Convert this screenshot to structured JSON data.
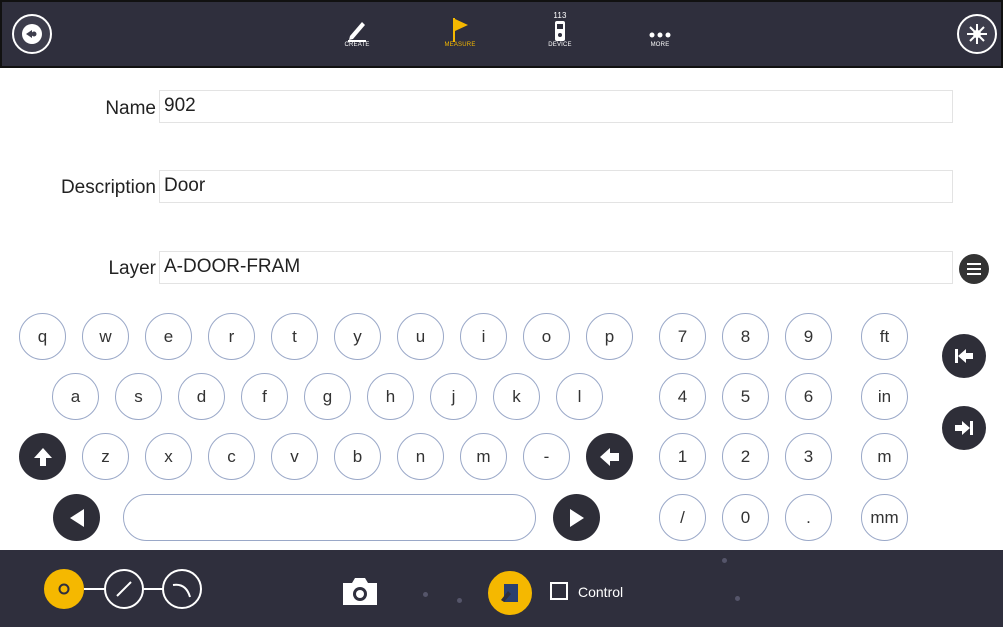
{
  "topbar": {
    "tabs": [
      {
        "label": "CREATE",
        "icon": "pencil-icon"
      },
      {
        "label": "MEASURE",
        "icon": "flag-icon"
      },
      {
        "label": "DEVICE",
        "icon": "device-icon"
      },
      {
        "label": "MORE",
        "icon": "more-dots-icon"
      }
    ],
    "left_icon": "back-target-icon",
    "right_icon": "laser-burst-icon",
    "device_badge": "113",
    "active_tab": "MEASURE",
    "active_color": "#f5b800"
  },
  "form": {
    "name_label": "Name",
    "name_value": "902",
    "description_label": "Description",
    "description_value": "Door",
    "layer_label": "Layer",
    "layer_value": "A-DOOR-FRAM"
  },
  "keyboard": {
    "row1": [
      "q",
      "w",
      "e",
      "r",
      "t",
      "y",
      "u",
      "i",
      "o",
      "p"
    ],
    "row2": [
      "a",
      "s",
      "d",
      "f",
      "g",
      "h",
      "j",
      "k",
      "l"
    ],
    "row3": [
      "z",
      "x",
      "c",
      "v",
      "b",
      "n",
      "m",
      "-"
    ],
    "numpad": [
      "7",
      "8",
      "9",
      "4",
      "5",
      "6",
      "1",
      "2",
      "3",
      "/",
      "0",
      "."
    ],
    "units": [
      "ft",
      "in",
      "m",
      "mm"
    ]
  },
  "bottombar": {
    "control_label": "Control",
    "modes": [
      "point-mode-icon",
      "line-mode-icon",
      "arc-mode-icon"
    ],
    "accent": "#f5b800"
  }
}
